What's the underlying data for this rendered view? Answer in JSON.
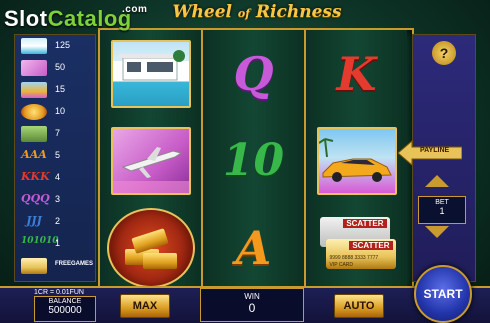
{
  "watermark": {
    "part1": "Slot",
    "part2": "Catalog",
    "com": ".com"
  },
  "game": {
    "title_a": "Wheel",
    "title_of": "of",
    "title_b": "Richness"
  },
  "paytable": [
    {
      "symbol": "villa-icon",
      "value": "125",
      "color": "#8fd0f0"
    },
    {
      "symbol": "jet-icon",
      "value": "50",
      "color": "#d378d6"
    },
    {
      "symbol": "car-icon",
      "value": "15",
      "color": "#e9b53a"
    },
    {
      "symbol": "gold-icon",
      "value": "10",
      "color": "#e59a1f"
    },
    {
      "symbol": "cash-icon",
      "value": "7",
      "color": "#76a84a"
    },
    {
      "symbol": "ace-icon",
      "value": "5",
      "color": "#f39a1e"
    },
    {
      "symbol": "king-icon",
      "value": "4",
      "color": "#e53a2e"
    },
    {
      "symbol": "queen-icon",
      "value": "3",
      "color": "#c65ad8"
    },
    {
      "symbol": "jack-icon",
      "value": "2",
      "color": "#3a7fd8"
    },
    {
      "symbol": "ten-icon",
      "value": "1",
      "color": "#38b84a"
    },
    {
      "symbol": "scatter-icon",
      "value": "FREEGAMES",
      "color": "#e7c35a"
    }
  ],
  "reels": {
    "reel1": [
      "villa-tile",
      "jet-tile",
      "gold-bars"
    ],
    "reel2": [
      "Q",
      "10",
      "A"
    ],
    "reel3": [
      "K",
      "car-tile",
      "scatter-cards"
    ]
  },
  "scatter": {
    "label": "SCATTER",
    "card_number": "9999 8888 3333 7777",
    "card_name": "VIP CARD"
  },
  "controls": {
    "help": "?",
    "payline": "PAYLINE",
    "bet_label": "BET",
    "bet_value": "1",
    "rate": "1CR = 0.01FUN",
    "balance_label": "BALANCE",
    "balance_value": "500000",
    "max": "MAX",
    "win_label": "WIN",
    "win_value": "0",
    "auto": "AUTO",
    "start": "START"
  }
}
